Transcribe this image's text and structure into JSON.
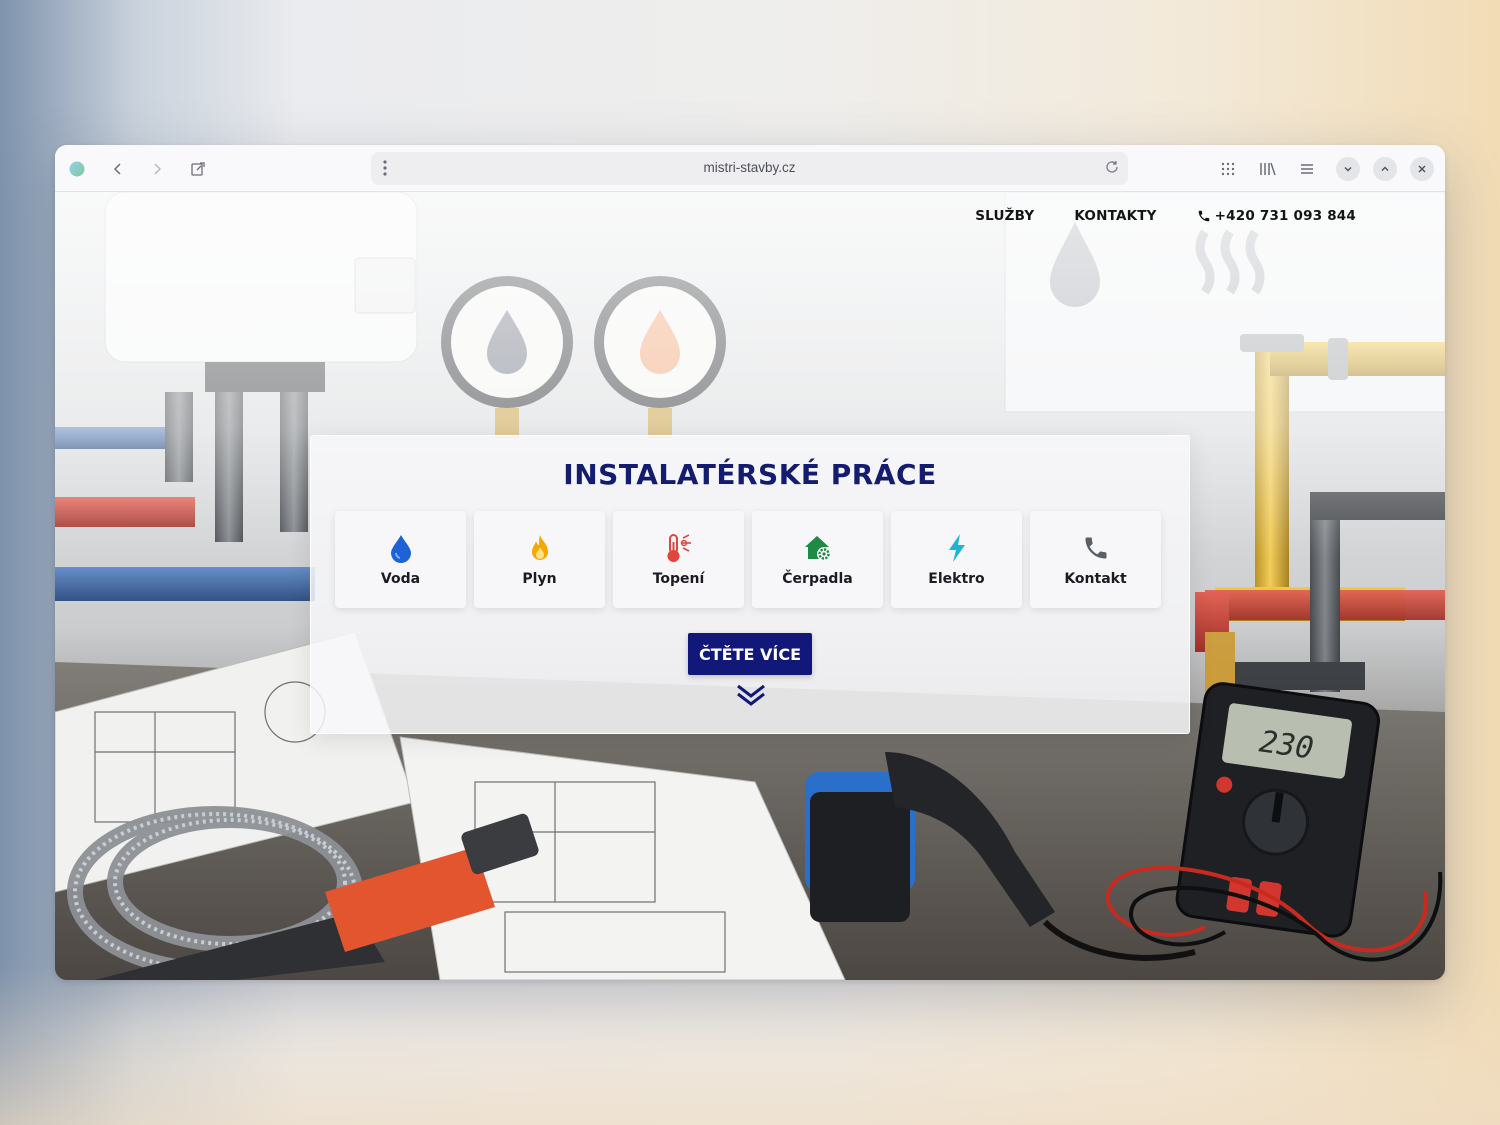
{
  "browser": {
    "url": "mistri-stavby.cz",
    "icons": [
      "browser-logo-icon",
      "back-icon",
      "forward-icon",
      "extension-icon",
      "menu-dots-icon",
      "reload-icon",
      "apps-grid-icon",
      "library-icon",
      "hamburger-menu-icon",
      "minimize-icon",
      "maximize-icon",
      "close-icon"
    ]
  },
  "nav": {
    "items": [
      {
        "label": "SLUŽBY"
      },
      {
        "label": "KONTAKTY"
      }
    ],
    "phone": "+420 731 093 844"
  },
  "hero": {
    "title": "INSTALATÉRSKÉ PRÁCE",
    "services": [
      {
        "label": "Voda",
        "icon": "water-drop-icon",
        "color": "#1e63d6"
      },
      {
        "label": "Plyn",
        "icon": "flame-icon",
        "color": "#f5a800"
      },
      {
        "label": "Topení",
        "icon": "thermometer-icon",
        "color": "#e0463c"
      },
      {
        "label": "Čerpadla",
        "icon": "house-gear-icon",
        "color": "#1f8a45"
      },
      {
        "label": "Elektro",
        "icon": "lightning-icon",
        "color": "#1eb4d6"
      },
      {
        "label": "Kontakt",
        "icon": "phone-icon",
        "color": "#5b5f66"
      }
    ],
    "cta_label": "ČTĚTE VÍCE"
  },
  "multimeter": {
    "display": "230"
  },
  "colors": {
    "brand_navy": "#12187a",
    "title_navy": "#131c6e"
  }
}
